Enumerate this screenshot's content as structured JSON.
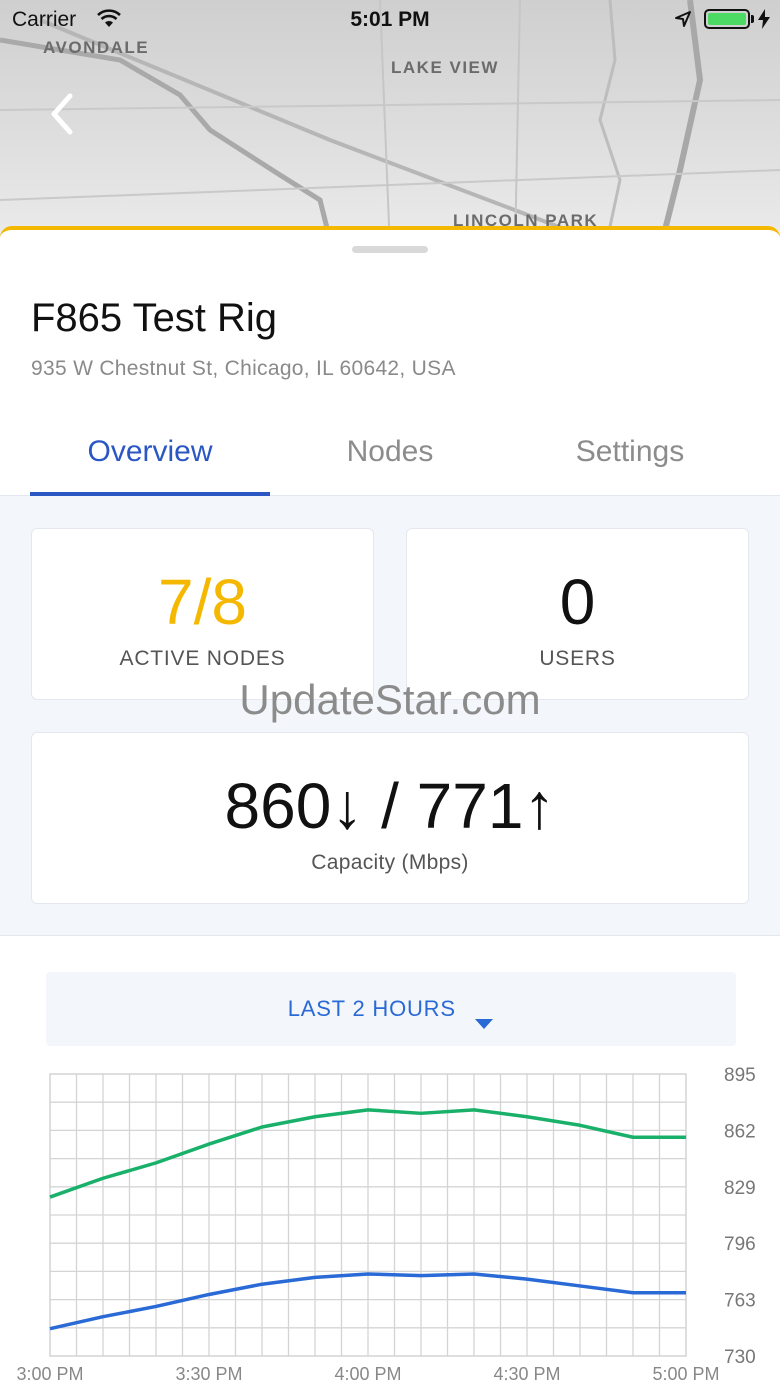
{
  "status_bar": {
    "carrier": "Carrier",
    "time": "5:01 PM"
  },
  "map": {
    "labels": [
      "AVONDALE",
      "LAKE VIEW",
      "LINCOLN PARK"
    ]
  },
  "site": {
    "name": "F865 Test Rig",
    "address": "935 W Chestnut St, Chicago, IL 60642, USA"
  },
  "tabs": [
    {
      "label": "Overview",
      "active": true
    },
    {
      "label": "Nodes",
      "active": false
    },
    {
      "label": "Settings",
      "active": false
    }
  ],
  "stats": {
    "active_nodes": {
      "value": "7/8",
      "label": "ACTIVE NODES"
    },
    "users": {
      "value": "0",
      "label": "USERS"
    },
    "capacity": {
      "value": "860↓ / 771↑",
      "label": "Capacity (Mbps)"
    }
  },
  "watermark": "UpdateStar.com",
  "time_range": {
    "label": "LAST 2 HOURS"
  },
  "colors": {
    "accent": "#2a57c4",
    "highlight": "#f5b800",
    "download": "#19b06a",
    "upload": "#2a6ad6"
  },
  "chart_data": {
    "type": "line",
    "x": [
      "3:00 PM",
      "3:10 PM",
      "3:20 PM",
      "3:30 PM",
      "3:40 PM",
      "3:50 PM",
      "4:00 PM",
      "4:10 PM",
      "4:20 PM",
      "4:30 PM",
      "4:40 PM",
      "4:50 PM",
      "5:00 PM"
    ],
    "x_tick_labels": [
      "3:00 PM",
      "3:30 PM",
      "4:00 PM",
      "4:30 PM",
      "5:00 PM"
    ],
    "y_ticks": [
      895,
      862,
      829,
      796,
      763,
      730
    ],
    "ylim": [
      730,
      895
    ],
    "grid": true,
    "series": [
      {
        "color": "#19b06a",
        "values": [
          823,
          834,
          843,
          854,
          864,
          870,
          874,
          872,
          874,
          870,
          865,
          858,
          858
        ]
      },
      {
        "color": "#2a6ad6",
        "values": [
          746,
          753,
          759,
          766,
          772,
          776,
          778,
          777,
          778,
          775,
          771,
          767,
          767
        ]
      }
    ]
  }
}
